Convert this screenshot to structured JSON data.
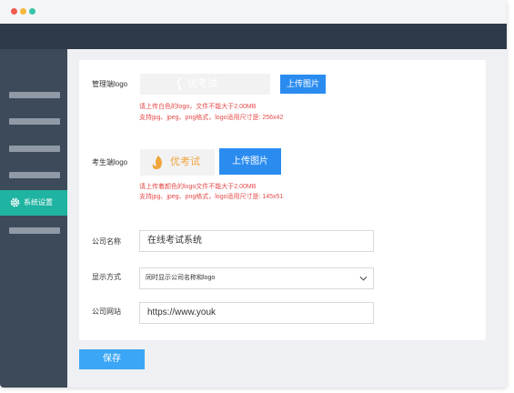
{
  "sidebar": {
    "active_item": {
      "label": "系统设置",
      "icon": "gear-icon"
    }
  },
  "form": {
    "admin_logo": {
      "label": "管理端logo",
      "logo_text": "优考试",
      "upload_label": "上传图片",
      "hint_line1": "请上传白色的logo，文件不能大于2.00MB",
      "hint_line2": "支持jpg、jpeg、png格式，logo适用尺寸是: 256x42"
    },
    "candidate_logo": {
      "label": "考生端logo",
      "logo_text": "优考试",
      "upload_label": "上传图片",
      "hint_line1": "请上传着颜色的logo文件不能大于2.00MB",
      "hint_line2": "支持jpg、jpeg、png格式，logo适用尺寸是: 145x51"
    },
    "company_name": {
      "label": "公司名称",
      "value": "在线考试系统"
    },
    "display_mode": {
      "label": "显示方式",
      "value": "同时显示公司名称和logo"
    },
    "company_site": {
      "label": "公司网站",
      "value": "https://www.youk"
    },
    "save_label": "保存"
  },
  "colors": {
    "accent": "#2b8cf0",
    "active_nav": "#1eb4a1",
    "hint": "#e54b4b",
    "logo_orange": "#f0a43a"
  }
}
